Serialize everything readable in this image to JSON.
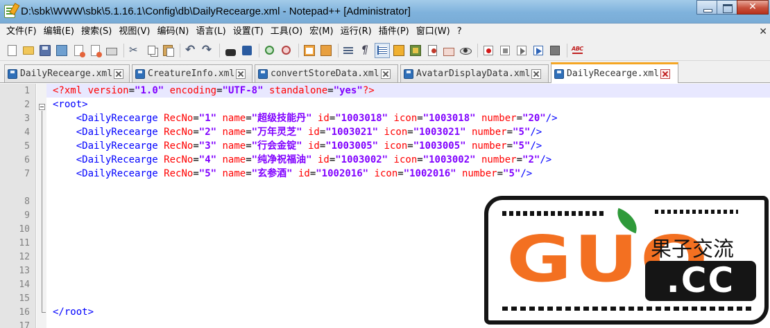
{
  "window": {
    "title": "D:\\sbk\\WWW\\sbk\\5.1.16.1\\Config\\db\\DailyRecearge.xml - Notepad++ [Administrator]"
  },
  "menu": [
    {
      "label": "文件(F)"
    },
    {
      "label": "编辑(E)"
    },
    {
      "label": "搜索(S)"
    },
    {
      "label": "视图(V)"
    },
    {
      "label": "编码(N)"
    },
    {
      "label": "语言(L)"
    },
    {
      "label": "设置(T)"
    },
    {
      "label": "工具(O)"
    },
    {
      "label": "宏(M)"
    },
    {
      "label": "运行(R)"
    },
    {
      "label": "插件(P)"
    },
    {
      "label": "窗口(W)"
    },
    {
      "label": "?"
    }
  ],
  "menubar_close": "✕",
  "tabs": [
    {
      "label": "DailyRecearge.xml",
      "active": false
    },
    {
      "label": "CreatureInfo.xml",
      "active": false
    },
    {
      "label": "convertStoreData.xml",
      "active": false
    },
    {
      "label": "AvatarDisplayData.xml",
      "active": false
    },
    {
      "label": "DailyRecearge.xml",
      "active": true
    }
  ],
  "line_numbers": [
    "1",
    "2",
    "3",
    "4",
    "5",
    "6",
    "7",
    "8",
    "9",
    "10",
    "11",
    "12",
    "13",
    "14",
    "15",
    "16",
    "17"
  ],
  "code": {
    "line1": {
      "open": "<?xml",
      "k1": "version",
      "eq1": "=",
      "v1": "\"1.0\"",
      "k2": "encoding",
      "eq2": "=",
      "v2": "\"UTF-8\"",
      "k3": "standalone",
      "eq3": "=",
      "v3": "\"yes\"",
      "close": "?>"
    },
    "line2": {
      "text": "<root>"
    },
    "records": [
      {
        "tag": "<DailyRecearge",
        "recno": "\"1\"",
        "name": "\"超级技能丹\"",
        "id": "\"1003018\"",
        "icon": "\"1003018\"",
        "number": "\"20\"",
        "end": "/>"
      },
      {
        "tag": "<DailyRecearge",
        "recno": "\"2\"",
        "name": "\"万年灵芝\"",
        "id": "\"1003021\"",
        "icon": "\"1003021\"",
        "number": "\"5\"",
        "end": "/>"
      },
      {
        "tag": "<DailyRecearge",
        "recno": "\"3\"",
        "name": "\"行会金锭\"",
        "id": "\"1003005\"",
        "icon": "\"1003005\"",
        "number": "\"5\"",
        "end": "/>"
      },
      {
        "tag": "<DailyRecearge",
        "recno": "\"4\"",
        "name": "\"纯净祝福油\"",
        "id": "\"1003002\"",
        "icon": "\"1003002\"",
        "number": "\"2\"",
        "end": "/>"
      },
      {
        "tag": "<DailyRecearge",
        "recno": "\"5\"",
        "name": "\"玄参酒\"",
        "id": "\"1002016\"",
        "icon": "\"1002016\"",
        "number": "\"5\"",
        "end": "/>"
      }
    ],
    "attr_names": {
      "recno": "RecNo",
      "name": "name",
      "id": "id",
      "icon": "icon",
      "number": "number",
      "eq": "="
    },
    "line17": {
      "text": "</root>"
    }
  },
  "watermark": {
    "brand": "GUO",
    "chinese": "果子交流",
    "domain": ".CC"
  },
  "colors": {
    "titlebar": "#7fb2dc",
    "tag": "#0000ff",
    "attribute": "#ff0000",
    "value": "#8000ff",
    "active_tab_accent": "#f5a623",
    "watermark_orange": "#f37021"
  }
}
